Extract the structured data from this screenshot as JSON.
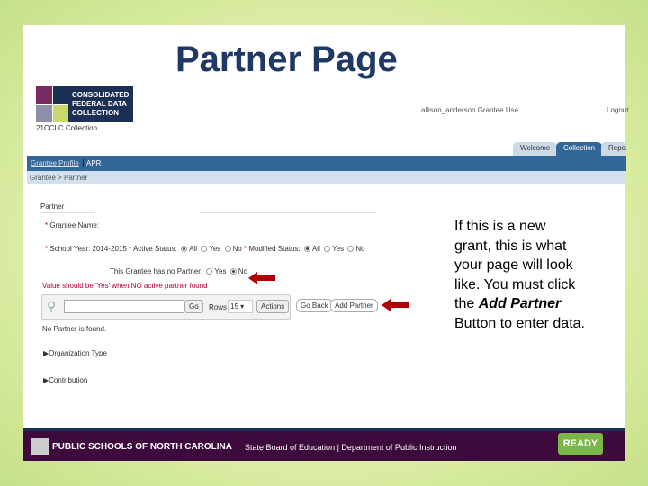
{
  "slide": {
    "title": "Partner Page",
    "note_lines": [
      "If this is a new",
      "grant, this is what",
      "your page will look",
      "like. You must click"
    ],
    "note_prefix": "the ",
    "note_emphasis": "Add Partner",
    "note_suffix": "Button to enter data."
  },
  "app": {
    "logo_text": [
      "CONSOLIDATED",
      "FEDERAL DATA",
      "COLLECTION"
    ],
    "collection": "21CCLC Collection",
    "user": "allison_anderson Grantee Use",
    "logout": "Logout",
    "tabs": [
      "Welcome",
      "Collection",
      "Report"
    ],
    "nav": [
      "Grantee Profile",
      "APR"
    ],
    "breadcrumb": "Grantee > Partner",
    "section": "Partner",
    "grantee_name_label": "Grantee Name:",
    "school_year_label": "School Year:",
    "school_year": "2014-2015",
    "active_status_label": "Active Status:",
    "modified_status_label": "Modified Status:",
    "opt_all": "All",
    "opt_yes": "Yes",
    "opt_no": "No",
    "no_partner_label": "This Grantee has no Partner:",
    "warning": "Value should be 'Yes' when NO active partner found",
    "search_value": "",
    "go": "Go",
    "rows_label": "Rows",
    "rows_value": "15",
    "actions": "Actions",
    "go_back": "Go Back",
    "add_partner": "Add Partner",
    "empty": "No Partner is found.",
    "sections": [
      "Organization Type",
      "Contribution"
    ]
  },
  "footer": {
    "org": "PUBLIC SCHOOLS OF NORTH CAROLINA",
    "sub": "State Board of Education | Department of Public Instruction",
    "badge": "READY"
  }
}
